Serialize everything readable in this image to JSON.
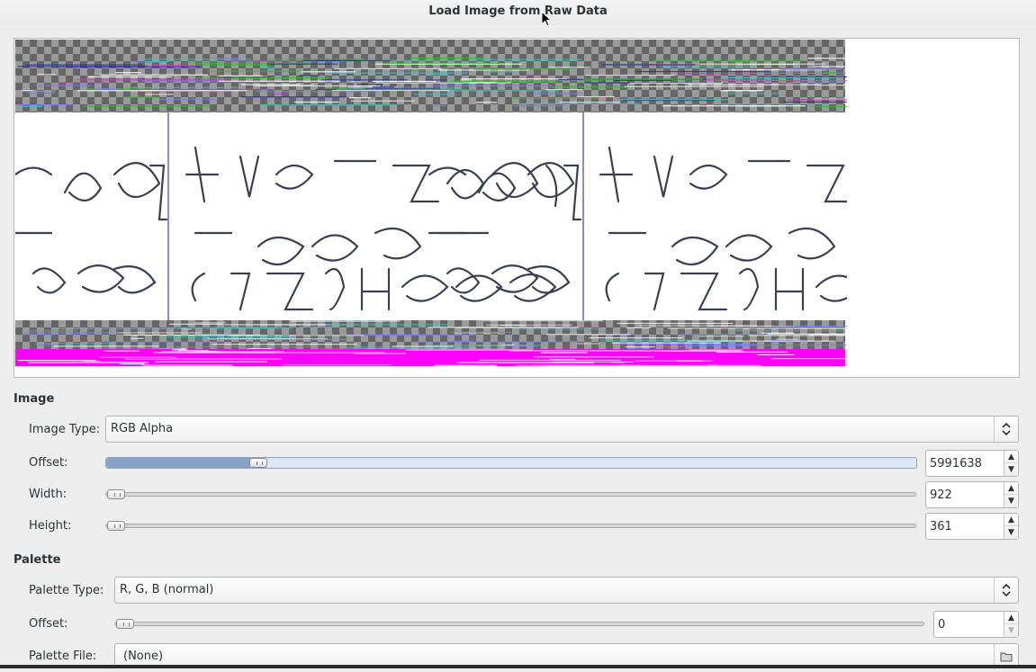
{
  "dialog": {
    "title": "Load Image from Raw Data"
  },
  "image_section": {
    "heading": "Image",
    "image_type_label": "Image Type:",
    "image_type_value": "RGB Alpha",
    "offset_label": "Offset:",
    "offset_value": "5991638",
    "offset_fraction": 0.18,
    "width_label": "Width:",
    "width_value": "922",
    "width_fraction": 0.0,
    "height_label": "Height:",
    "height_value": "361",
    "height_fraction": 0.0
  },
  "palette_section": {
    "heading": "Palette",
    "palette_type_label": "Palette Type:",
    "palette_type_value": "R, G, B (normal)",
    "offset_label": "Offset:",
    "offset_value": "0",
    "offset_fraction": 0.0,
    "palette_file_label": "Palette File:",
    "palette_file_value": "(None)"
  },
  "icons": {
    "combo_arrow": "up-down-chevron-icon",
    "folder": "folder-icon",
    "cursor": "mouse-pointer-icon"
  },
  "colors": {
    "magenta": "#ff00ff",
    "guide_line": "#1a1aa8"
  }
}
